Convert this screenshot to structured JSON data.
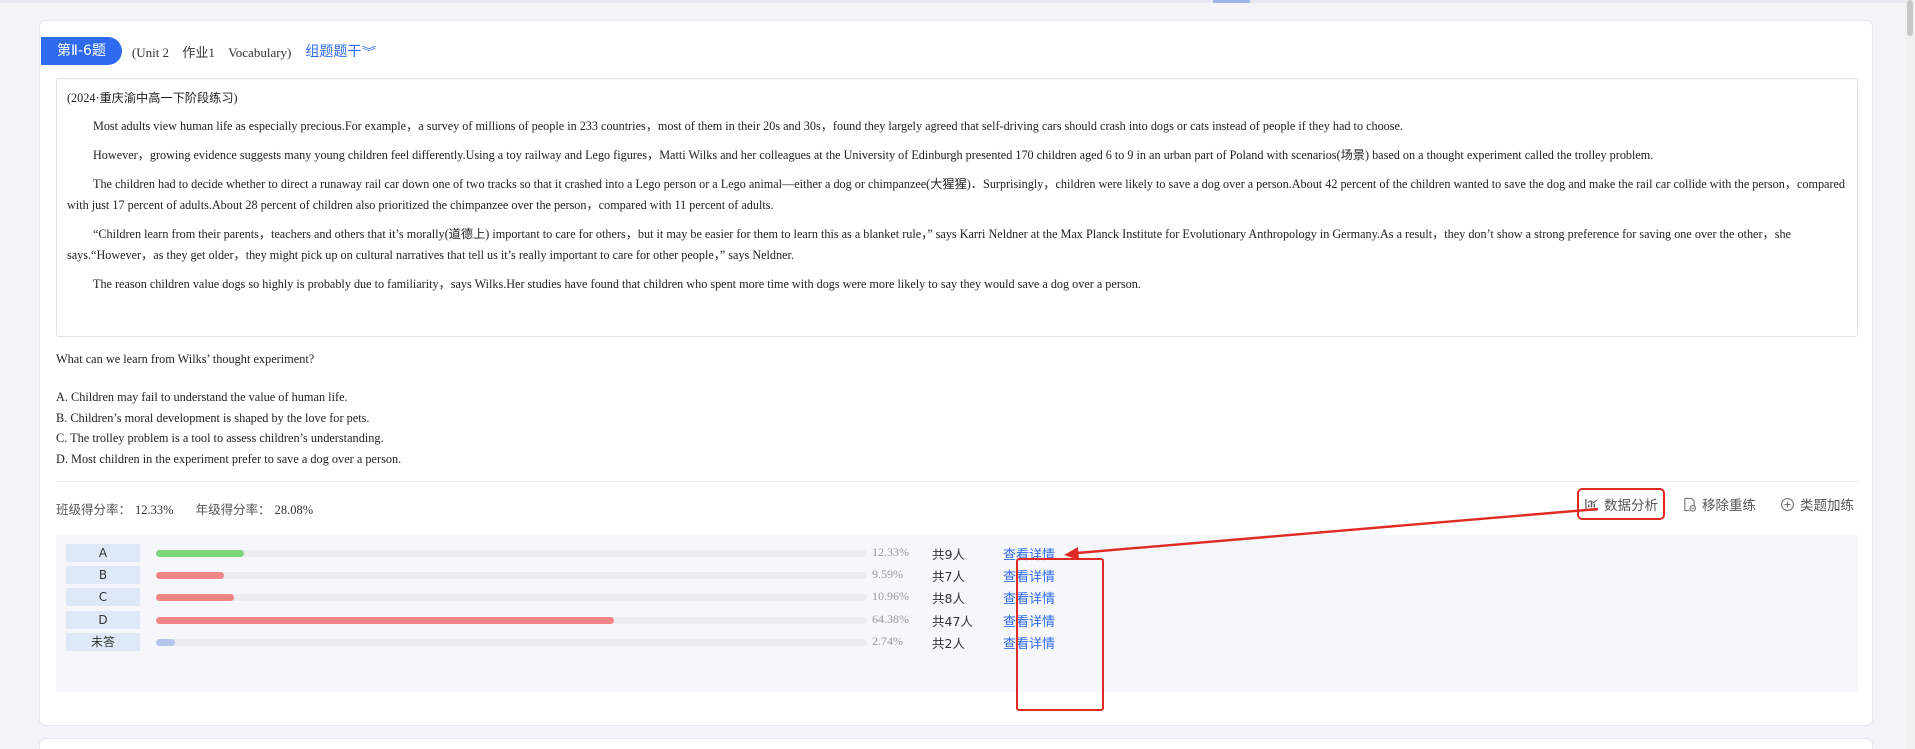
{
  "question": {
    "badge": "第Ⅱ-6题",
    "unit": "(Unit 2",
    "homework": "作业1",
    "category": "Vocabulary)",
    "group_link": "组题题干",
    "source": "(2024·重庆渝中高一下阶段练习)",
    "paragraphs": [
      "Most adults view human life as especially precious.For example，a survey of millions of people in 233 countries，most of them in their 20s and 30s，found they largely agreed that self-driving cars should crash into dogs or cats instead of people if they had to choose.",
      "However，growing evidence suggests many young children feel differently.Using a toy railway and Lego figures，Matti Wilks and her colleagues at the University of Edinburgh presented 170 children aged 6 to 9 in an urban part of Poland with scenarios(场景) based on a thought experiment called the trolley problem.",
      "The children had to decide whether to direct a runaway rail car down one of two tracks so that it crashed into a Lego person or a Lego animal—either a dog or chimpanzee(大猩猩)．Surprisingly，children were likely to save a dog over a person.About 42 percent of the children wanted to save the dog and make the rail car collide with the person，compared with just 17 percent of adults.About 28 percent of children also prioritized the chimpanzee over the person，compared with 11 percent of adults.",
      "“Children learn from their parents，teachers and others that it’s morally(道德上) important to care for others，but it may be easier for them to learn this as a blanket rule，” says Karri Neldner at the Max Planck Institute for Evolutionary Anthropology in Germany.As a result，they don’t show a strong preference for saving one over the other，she says.“However，as they get older，they might pick up on cultural narratives that tell us it’s really important to care for other people，” says Neldner.",
      "The reason children value dogs so highly is probably due to familiarity，says Wilks.Her studies have found that children who spent more time with dogs were more likely to say they would save a dog over a person."
    ],
    "stem": "What can we learn from Wilks’ thought experiment?",
    "options": [
      "A. Children may fail to understand the value of human life.",
      "B. Children’s moral development is shaped by the love for pets.",
      "C. The trolley problem is a tool to assess children’s understanding.",
      "D. Most children in the experiment prefer to save a dog over a person."
    ]
  },
  "scores": {
    "class_label": "班级得分率：",
    "class_value": "12.33%",
    "grade_label": "年级得分率：",
    "grade_value": "28.08%"
  },
  "tools": {
    "analysis": "数据分析",
    "remove": "移除重练",
    "similar": "类题加练"
  },
  "stats": [
    {
      "option": "A",
      "fraction": 0.1233,
      "percent": "12.33%",
      "count": "共9人",
      "detail": "查看详情",
      "color": "#7ed67a"
    },
    {
      "option": "B",
      "fraction": 0.0959,
      "percent": "9.59%",
      "count": "共7人",
      "detail": "查看详情",
      "color": "#f08585"
    },
    {
      "option": "C",
      "fraction": 0.1096,
      "percent": "10.96%",
      "count": "共8人",
      "detail": "查看详情",
      "color": "#f08585"
    },
    {
      "option": "D",
      "fraction": 0.6438,
      "percent": "64.38%",
      "count": "共47人",
      "detail": "查看详情",
      "color": "#f08585"
    },
    {
      "option": "未答",
      "fraction": 0.0274,
      "percent": "2.74%",
      "count": "共2人",
      "detail": "查看详情",
      "color": "#b4c6ee"
    }
  ],
  "colors": {
    "accent": "#2f6bf0",
    "annotation": "#e02a24"
  }
}
